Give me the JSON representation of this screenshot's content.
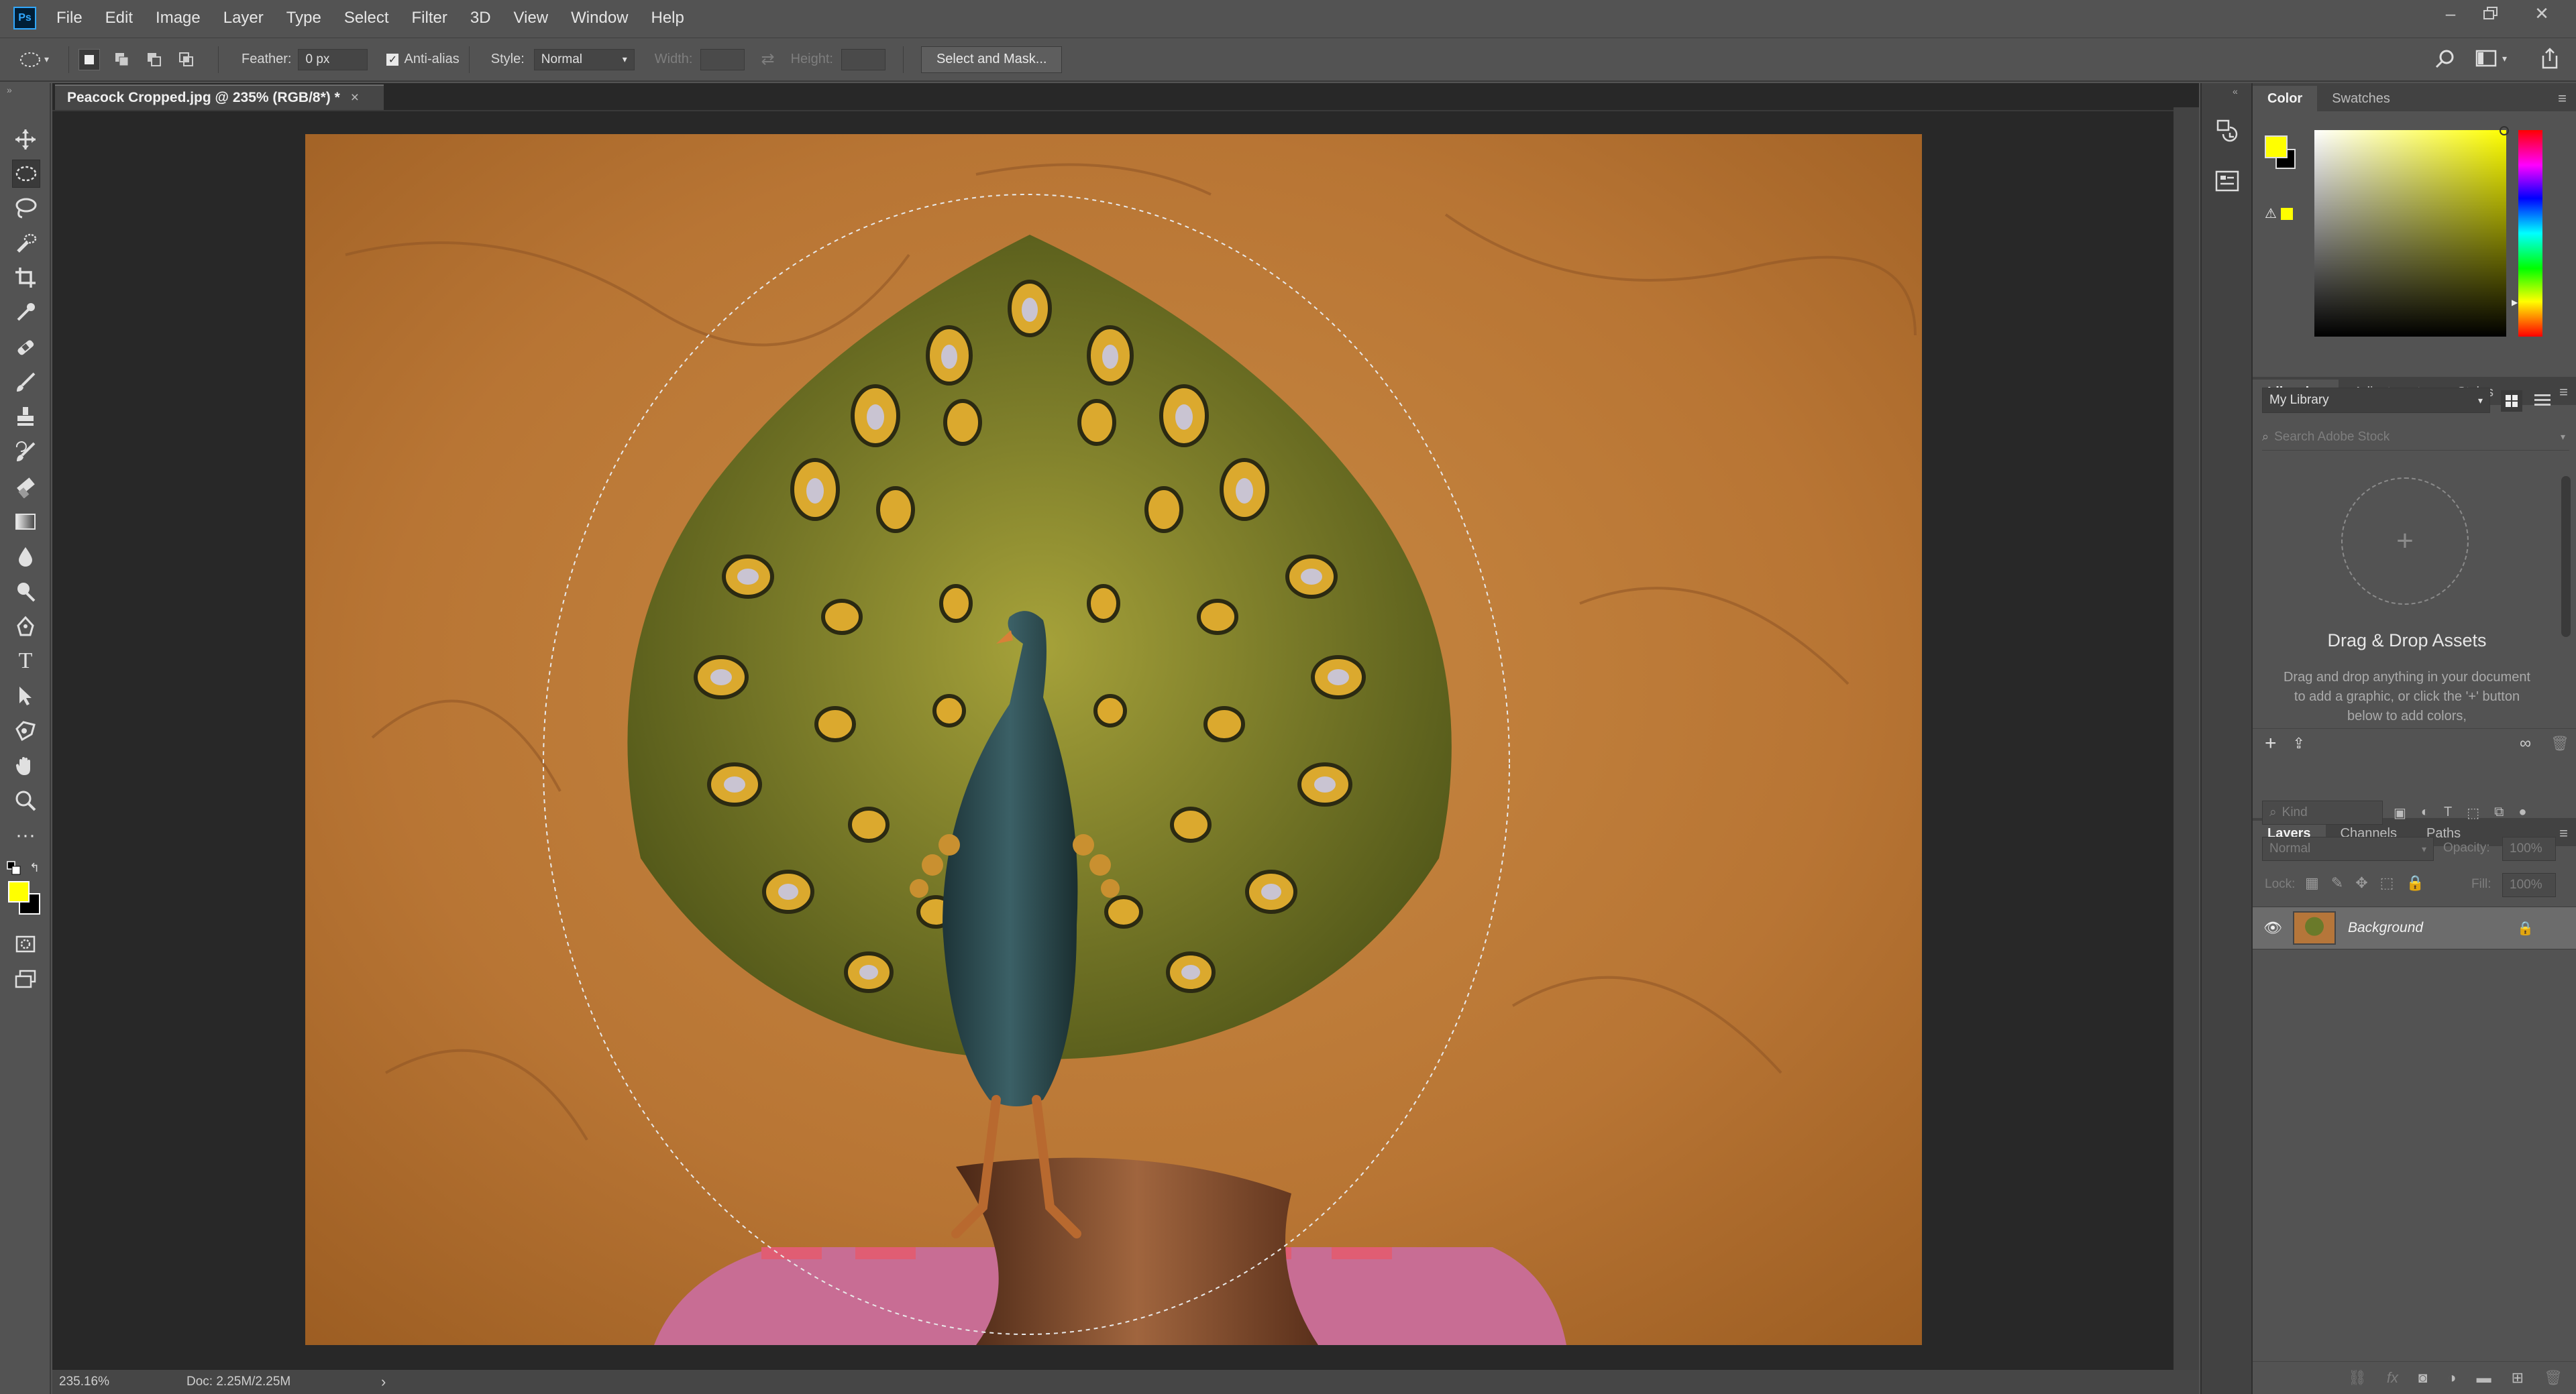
{
  "app": {
    "logo": "Ps"
  },
  "menu": [
    "File",
    "Edit",
    "Image",
    "Layer",
    "Type",
    "Select",
    "Filter",
    "3D",
    "View",
    "Window",
    "Help"
  ],
  "options": {
    "feather_label": "Feather:",
    "feather_value": "0 px",
    "anti_alias_label": "Anti-alias",
    "style_label": "Style:",
    "style_value": "Normal",
    "width_label": "Width:",
    "height_label": "Height:",
    "select_mask_label": "Select and Mask..."
  },
  "document": {
    "tab_title": "Peacock Cropped.jpg @ 235% (RGB/8*) *",
    "close": "×",
    "zoom": "235.16%",
    "doc_size": "Doc: 2.25M/2.25M",
    "status_arrow": "›"
  },
  "color_panel": {
    "tabs": [
      "Color",
      "Swatches"
    ],
    "foreground": "#ffff00",
    "background": "#000000"
  },
  "libraries_panel": {
    "tabs": [
      "Libraries",
      "Adjustments",
      "Styles"
    ],
    "library": "My Library",
    "search_placeholder": "Search Adobe Stock",
    "drop_title": "Drag & Drop Assets",
    "drop_text": "Drag and drop anything in your document to add a graphic, or click the '+' button below to add colors,"
  },
  "layers_panel": {
    "tabs": [
      "Layers",
      "Channels",
      "Paths"
    ],
    "filter": "Kind",
    "blend_mode": "Normal",
    "opacity_label": "Opacity:",
    "opacity_value": "100%",
    "lock_label": "Lock:",
    "fill_label": "Fill:",
    "fill_value": "100%",
    "layers": [
      {
        "name": "Background"
      }
    ]
  }
}
